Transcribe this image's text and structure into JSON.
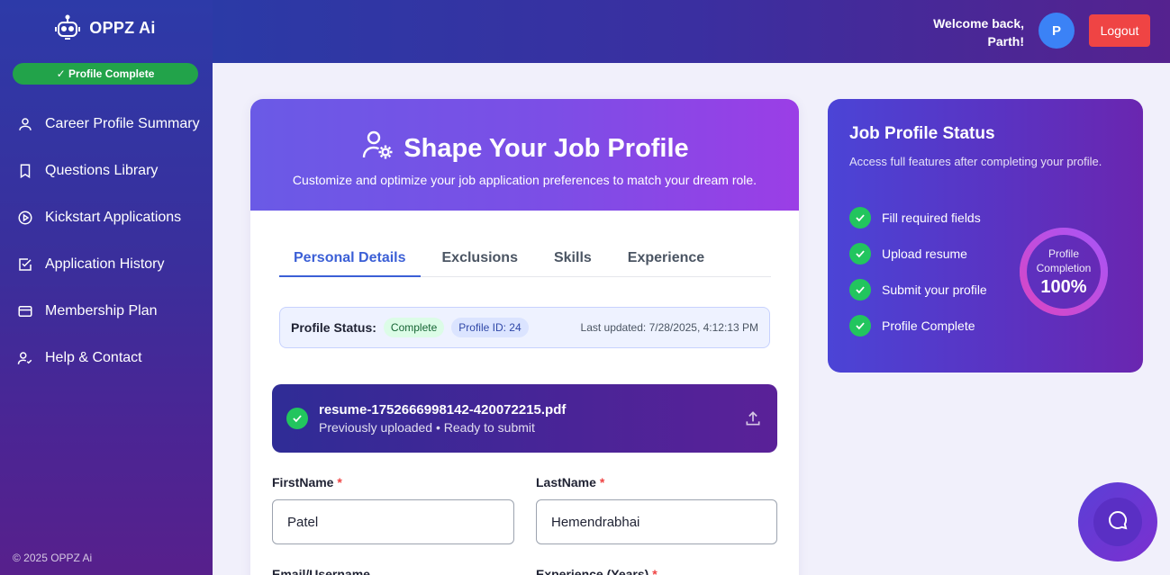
{
  "brand": {
    "name": "OPPZ Ai",
    "profile_pill": "✓ Profile Complete",
    "footer": "© 2025 OPPZ Ai"
  },
  "sidebar": {
    "items": [
      {
        "label": "Career Profile Summary",
        "icon": "user-icon"
      },
      {
        "label": "Questions Library",
        "icon": "bookmark-icon"
      },
      {
        "label": "Kickstart Applications",
        "icon": "play-circle-icon"
      },
      {
        "label": "Application History",
        "icon": "check-square-icon"
      },
      {
        "label": "Membership Plan",
        "icon": "credit-card-icon"
      },
      {
        "label": "Help & Contact",
        "icon": "user-check-icon"
      }
    ]
  },
  "header": {
    "welcome_line1": "Welcome back,",
    "welcome_line2": "Parth!",
    "avatar_initial": "P",
    "logout_label": "Logout"
  },
  "hero": {
    "title": "Shape Your Job Profile",
    "subtitle": "Customize and optimize your job application preferences to match your dream role."
  },
  "tabs": [
    {
      "label": "Personal Details",
      "active": true
    },
    {
      "label": "Exclusions",
      "active": false
    },
    {
      "label": "Skills",
      "active": false
    },
    {
      "label": "Experience",
      "active": false
    }
  ],
  "status_bar": {
    "label": "Profile Status:",
    "status": "Complete",
    "profile_id": "Profile ID: 24",
    "last_updated": "Last updated: 7/28/2025, 4:12:13 PM"
  },
  "resume": {
    "filename": "resume-1752666998142-420072215.pdf",
    "subtitle": "Previously uploaded • Ready to submit"
  },
  "form": {
    "first_name_label": "FirstName",
    "first_name_value": "Patel",
    "last_name_label": "LastName",
    "last_name_value": "Hemendrabhai",
    "email_label": "Email/Username",
    "experience_label": "Experience (Years)",
    "required_mark": "*"
  },
  "status_card": {
    "title": "Job Profile Status",
    "subtitle": "Access full features after completing your profile.",
    "items": [
      "Fill required fields",
      "Upload resume",
      "Submit your profile",
      "Profile Complete"
    ],
    "ring_label_1": "Profile",
    "ring_label_2": "Completion",
    "ring_value": "100%",
    "completion": 1.0
  },
  "colors": {
    "accent": "#3b5fd6",
    "success": "#22c55e",
    "danger": "#ef4444"
  }
}
